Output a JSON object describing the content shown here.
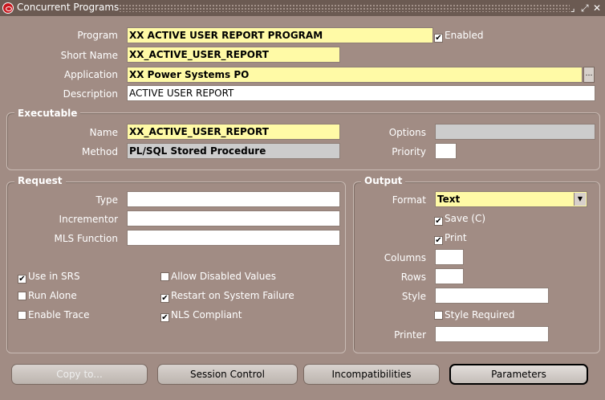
{
  "window": {
    "title": "Concurrent Programs",
    "controls": {
      "minimize": "⌟",
      "restore": "⤢",
      "close": "✕"
    }
  },
  "program_section": {
    "program_label": "Program",
    "program_value": "XX ACTIVE USER REPORT PROGRAM",
    "enabled_label": "Enabled",
    "enabled_checked": "✔",
    "short_name_label": "Short Name",
    "short_name_value": "XX_ACTIVE_USER_REPORT",
    "application_label": "Application",
    "application_value": "XX Power Systems PO",
    "application_lov": "…",
    "description_label": "Description",
    "description_value": "ACTIVE USER REPORT"
  },
  "executable": {
    "title": "Executable",
    "name_label": "Name",
    "name_value": "XX_ACTIVE_USER_REPORT",
    "method_label": "Method",
    "method_value": "PL/SQL Stored Procedure",
    "options_label": "Options",
    "options_value": "",
    "priority_label": "Priority",
    "priority_value": ""
  },
  "request": {
    "title": "Request",
    "type_label": "Type",
    "incrementor_label": "Incrementor",
    "mls_function_label": "MLS Function",
    "checkboxes": {
      "use_in_srs": {
        "label": "Use in SRS",
        "mark": "✔"
      },
      "run_alone": {
        "label": "Run Alone",
        "mark": ""
      },
      "enable_trace": {
        "label": "Enable Trace",
        "mark": ""
      },
      "allow_disabled": {
        "label": "Allow Disabled Values",
        "mark": ""
      },
      "restart_on_failure": {
        "label": "Restart on System Failure",
        "mark": "✔"
      },
      "nls_compliant": {
        "label": "NLS Compliant",
        "mark": "✔"
      }
    }
  },
  "output": {
    "title": "Output",
    "format_label": "Format",
    "format_value": "Text",
    "save_label": "Save (C)",
    "save_mark": "✔",
    "print_label": "Print",
    "print_mark": "✔",
    "columns_label": "Columns",
    "rows_label": "Rows",
    "style_label": "Style",
    "style_required_label": "Style Required",
    "style_required_mark": "",
    "printer_label": "Printer"
  },
  "buttons": {
    "copy_to": "Copy to...",
    "session_control": "Session Control",
    "incompatibilities": "Incompatibilities",
    "parameters": "Parameters"
  },
  "icons": [
    "oracle-app-icon",
    "minimize-icon",
    "restore-icon",
    "close-icon",
    "lov-icon",
    "dropdown-arrow-icon",
    "checkbox-check-icon"
  ],
  "colors": {
    "canvas": "#a18c84",
    "required_field": "#fffaa6",
    "readonly_field": "#cccccc",
    "titlebar": "#6b5a52"
  }
}
